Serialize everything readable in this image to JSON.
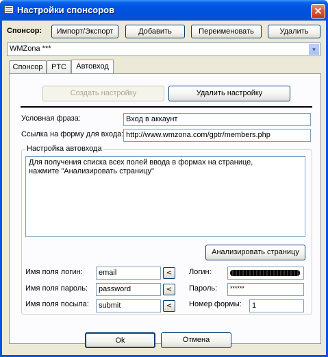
{
  "window": {
    "title": "Настройки спонсоров",
    "close_glyph": "✕"
  },
  "sponsor_bar": {
    "label": "Спонсор:",
    "import_export": "Импорт/Экспорт",
    "add": "Добавить",
    "rename": "Переименовать",
    "delete": "Удалить"
  },
  "sponsor_select": {
    "value": "WMZona ***",
    "arrow_glyph": "▼"
  },
  "tabs": [
    {
      "label": "Спонсор"
    },
    {
      "label": "PTC"
    },
    {
      "label": "Автовход"
    }
  ],
  "autologin": {
    "create_setting": "Создать настройку",
    "delete_setting": "Удалить настройку",
    "phrase_label": "Условная фраза:",
    "phrase_value": "Вход в аккаунт",
    "form_link_label": "Ссылка на форму для входа:",
    "form_link_value": "http://www.wmzona.com/gptr/members.php",
    "group_title": "Настройка автовхода",
    "info_text_line1": "Для получения списка всех полей ввода в формах на странице,",
    "info_text_line2": "нажмите \"Анализировать страницу\"",
    "analyze_button": "Анализировать страницу",
    "login_field_label": "Имя поля логин:",
    "login_field_value": "email",
    "password_field_label": "Имя поля пароль:",
    "password_field_value": "password",
    "submit_field_label": "Имя поля посыла:",
    "submit_field_value": "submit",
    "pick_glyph": "<",
    "login_label": "Логин:",
    "password_label": "Пароль:",
    "password_value": "******",
    "form_number_label": "Номер формы:",
    "form_number_value": "1"
  },
  "footer": {
    "ok": "Ok",
    "cancel": "Отмена"
  }
}
